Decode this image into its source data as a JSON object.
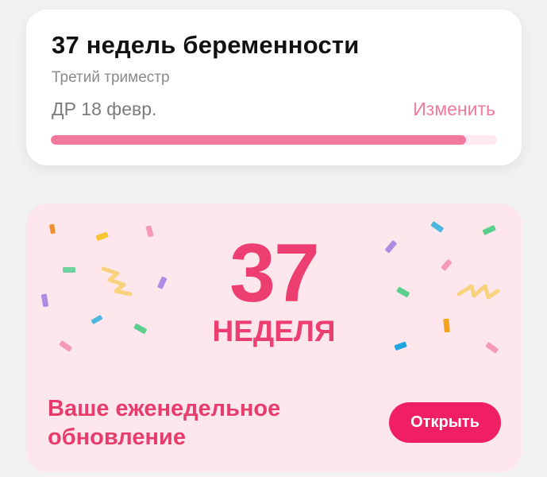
{
  "pregnancy": {
    "title": "37 недель беременности",
    "trimester": "Третий триместр",
    "due_date": "ДР 18 февр.",
    "change_label": "Изменить",
    "progress": 0.93,
    "progress_color": "#f07a9d",
    "progress_track_color": "#fde9ef"
  },
  "weekly": {
    "week_number": "37",
    "week_word": "НЕДЕЛЯ",
    "update_text": "Ваше еженедельное обновление",
    "open_label": "Открыть",
    "accent_color": "#ec3e71",
    "button_color": "#f01f64",
    "background_color": "#fde7ec"
  }
}
